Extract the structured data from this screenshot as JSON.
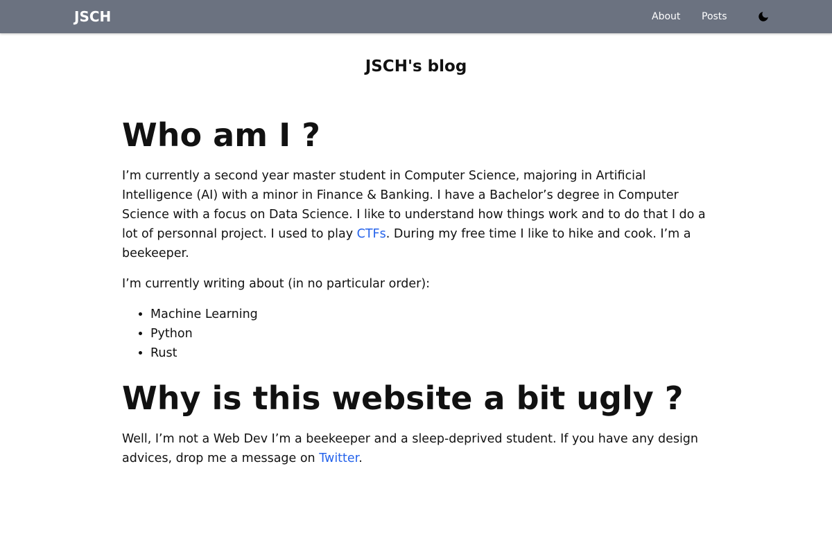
{
  "navbar": {
    "brand": "JSCH",
    "links": [
      {
        "label": "About"
      },
      {
        "label": "Posts"
      }
    ],
    "theme_toggle_icon": "moon-icon"
  },
  "site_title": "JSCH's blog",
  "sections": [
    {
      "heading": "Who am I ?",
      "paragraph1": {
        "before": "I’m currently a second year master student in Computer Science, majoring in Artificial Intelligence (AI) with a minor in Finance & Banking. I have a Bachelor’s degree in Computer Science with a focus on Data Science. I like to understand how things work and to do that I do a lot of personnal project. I used to play ",
        "link": "CTFs",
        "after": ". During my free time I like to hike and cook. I’m a beekeeper."
      },
      "paragraph2": "I’m currently writing about (in no particular order):",
      "topics": [
        "Machine Learning",
        "Python",
        "Rust"
      ]
    },
    {
      "heading": "Why is this website a bit ugly ?",
      "paragraph1": {
        "before": "Well, I’m not a Web Dev I’m a beekeeper and a sleep-deprived student. If you have any design advices, drop me a message on ",
        "link": "Twitter",
        "after": "."
      }
    }
  ],
  "colors": {
    "navbar_bg": "#6b7280",
    "link": "#2563eb",
    "text": "#111111"
  }
}
